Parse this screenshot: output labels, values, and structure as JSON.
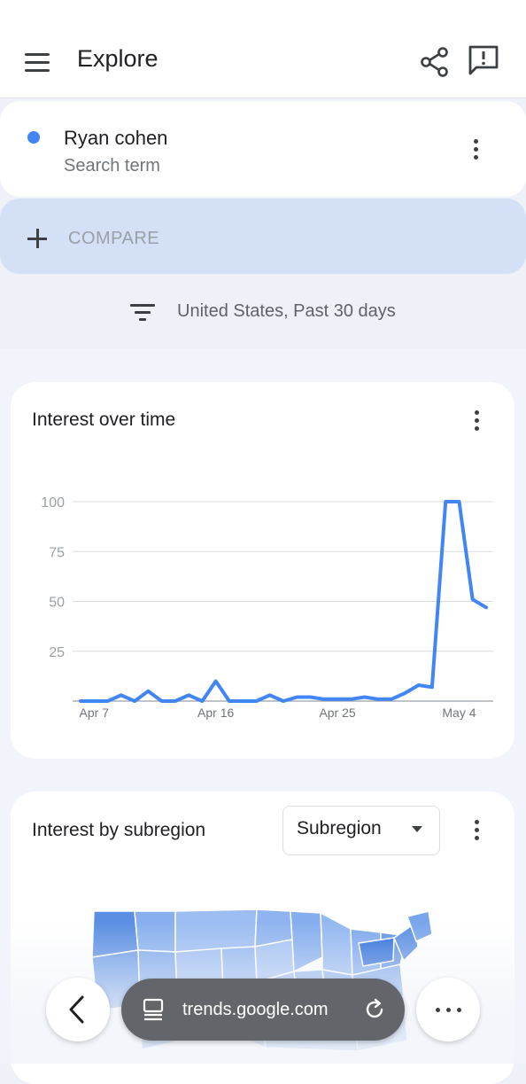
{
  "header": {
    "title": "Explore",
    "menu_icon": "hamburger-menu-icon",
    "share_icon": "share-icon",
    "feedback_icon": "feedback-icon"
  },
  "search_term": {
    "name": "Ryan cohen",
    "type": "Search term",
    "color": "#4285f4"
  },
  "compare": {
    "label": "COMPARE"
  },
  "filter": {
    "text": "United States, Past 30 days"
  },
  "interest_over_time": {
    "title": "Interest over time",
    "chart_data": {
      "type": "line",
      "x": [
        "Apr 6",
        "Apr 7",
        "Apr 8",
        "Apr 9",
        "Apr 10",
        "Apr 11",
        "Apr 12",
        "Apr 13",
        "Apr 14",
        "Apr 15",
        "Apr 16",
        "Apr 17",
        "Apr 18",
        "Apr 19",
        "Apr 20",
        "Apr 21",
        "Apr 22",
        "Apr 23",
        "Apr 24",
        "Apr 25",
        "Apr 26",
        "Apr 27",
        "Apr 28",
        "Apr 29",
        "Apr 30",
        "May 1",
        "May 2",
        "May 3",
        "May 4",
        "May 5",
        "May 6",
        "May 7"
      ],
      "series": [
        {
          "values": [
            0,
            0,
            0,
            3,
            0,
            5,
            0,
            0,
            3,
            0,
            10,
            0,
            0,
            0,
            3,
            0,
            2,
            2,
            1,
            1,
            1,
            2,
            1,
            1,
            4,
            8,
            7,
            100,
            100,
            51,
            47
          ]
        }
      ],
      "xticks": [
        "Apr 7",
        "Apr 16",
        "Apr 25",
        "May 4"
      ],
      "yticks": [
        25,
        50,
        75,
        100
      ],
      "ylim": [
        0,
        100
      ],
      "grid": true,
      "color": "#4285f4"
    }
  },
  "subregion": {
    "title": "Interest by subregion",
    "select_value": "Subregion"
  },
  "browser": {
    "url": "trends.google.com"
  }
}
